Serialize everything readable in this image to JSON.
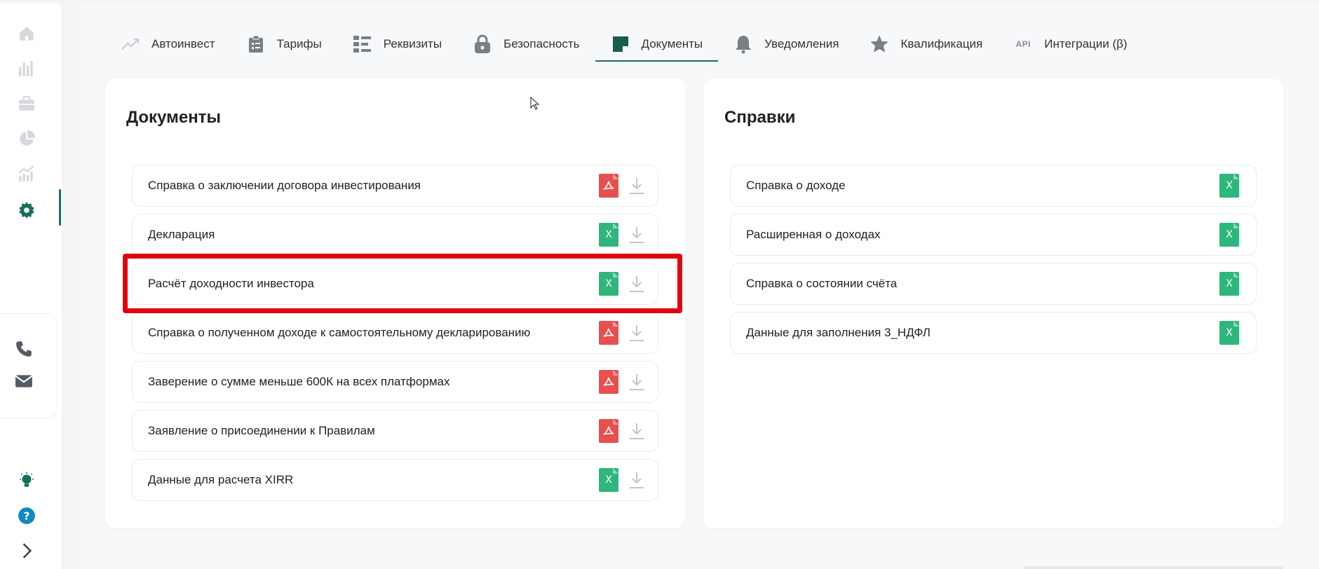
{
  "sidebar": {
    "icons": [
      "home-icon",
      "bar-chart-icon",
      "briefcase-icon",
      "pie-chart-icon",
      "growth-chart-icon",
      "gear-icon"
    ],
    "contact_icons": [
      "phone-icon",
      "mail-icon"
    ],
    "bottom_icons": [
      "lightbulb-icon",
      "help-icon",
      "chevron-right-icon"
    ],
    "accent_color": "#1a6e5c"
  },
  "tabs": [
    {
      "label": "Автоинвест",
      "icon": "trend-up-icon"
    },
    {
      "label": "Тарифы",
      "icon": "clipboard-icon"
    },
    {
      "label": "Реквизиты",
      "icon": "list-icon"
    },
    {
      "label": "Безопасность",
      "icon": "lock-icon"
    },
    {
      "label": "Документы",
      "icon": "document-icon",
      "active": true
    },
    {
      "label": "Уведомления",
      "icon": "bell-icon"
    },
    {
      "label": "Квалификация",
      "icon": "star-icon"
    },
    {
      "label": "Интеграции (β)",
      "icon": "api-icon",
      "icon_text": "API"
    }
  ],
  "documents": {
    "title": "Документы",
    "items": [
      {
        "label": "Справка о заключении договора инвестирования",
        "type": "pdf"
      },
      {
        "label": "Декларация",
        "type": "xls"
      },
      {
        "label": "Расчёт доходности инвестора",
        "type": "xls"
      },
      {
        "label": "Справка о полученном доходе к самостоятельному декларированию",
        "type": "pdf"
      },
      {
        "label": "Заверение о сумме меньше 600К на всех платформах",
        "type": "pdf"
      },
      {
        "label": "Заявление о присоединении к Правилам",
        "type": "pdf"
      },
      {
        "label": "Данные для расчета XIRR",
        "type": "xls"
      }
    ]
  },
  "certificates": {
    "title": "Справки",
    "items": [
      {
        "label": "Справка о доходе",
        "type": "xls"
      },
      {
        "label": "Расширенная о доходах",
        "type": "xls"
      },
      {
        "label": "Справка о состоянии счёта",
        "type": "xls"
      },
      {
        "label": "Данные для заполнения 3_НДФЛ",
        "type": "xls"
      }
    ]
  },
  "file_icon_text": {
    "xls": "X"
  },
  "colors": {
    "pdf": "#e94f4f",
    "xls": "#2eb67d",
    "highlight": "#e3000f"
  }
}
